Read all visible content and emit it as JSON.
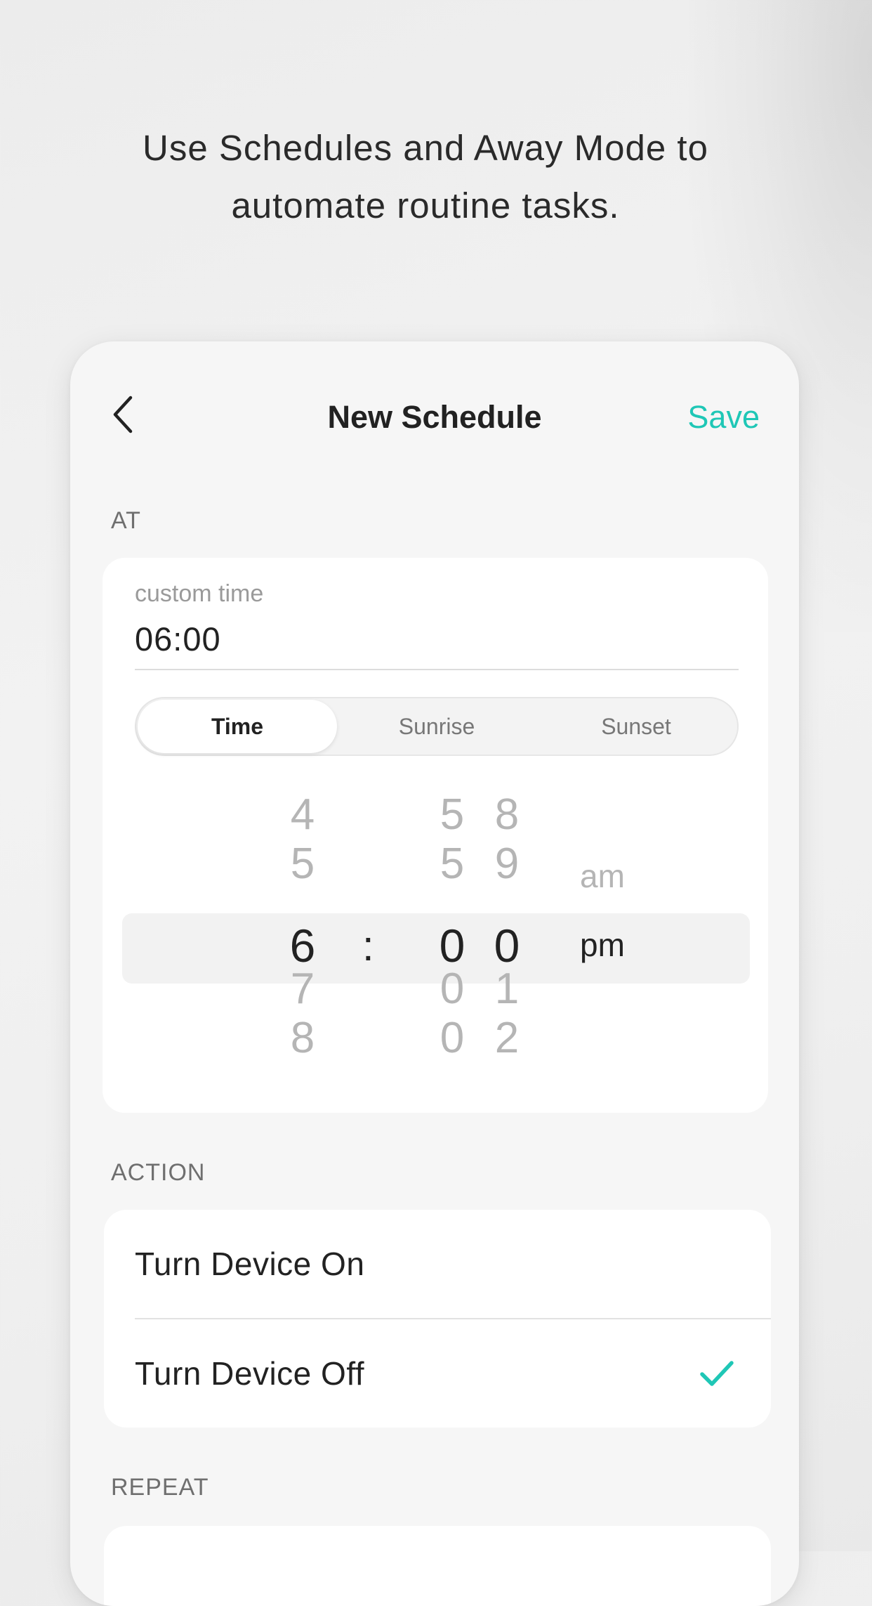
{
  "tagline": {
    "line1": "Use Schedules and Away Mode to",
    "line2": "automate routine tasks."
  },
  "nav": {
    "back_icon": "chevron-left-icon",
    "title": "New Schedule",
    "save_label": "Save"
  },
  "colors": {
    "accent": "#1fc7b6",
    "text": "#222222",
    "muted": "#b5b5b5"
  },
  "at_section": {
    "label": "AT",
    "field_caption": "custom time",
    "field_value": "06:00",
    "segments": [
      "Time",
      "Sunrise",
      "Sunset"
    ],
    "selected_segment": "Time"
  },
  "picker": {
    "hours": [
      "4",
      "5",
      "6",
      "7",
      "8"
    ],
    "minutes_tens": [
      "5",
      "5",
      "0",
      "0",
      "0"
    ],
    "minutes_ones": [
      "8",
      "9",
      "0",
      "1",
      "2"
    ],
    "separator": ":",
    "ampm": [
      "am",
      "pm"
    ],
    "selected_hour": "6",
    "selected_minute": "00",
    "selected_period": "pm"
  },
  "action_section": {
    "label": "ACTION",
    "options": [
      "Turn Device On",
      "Turn Device Off"
    ],
    "selected": "Turn Device Off",
    "check_icon": "checkmark-icon"
  },
  "repeat_section": {
    "label": "REPEAT"
  }
}
